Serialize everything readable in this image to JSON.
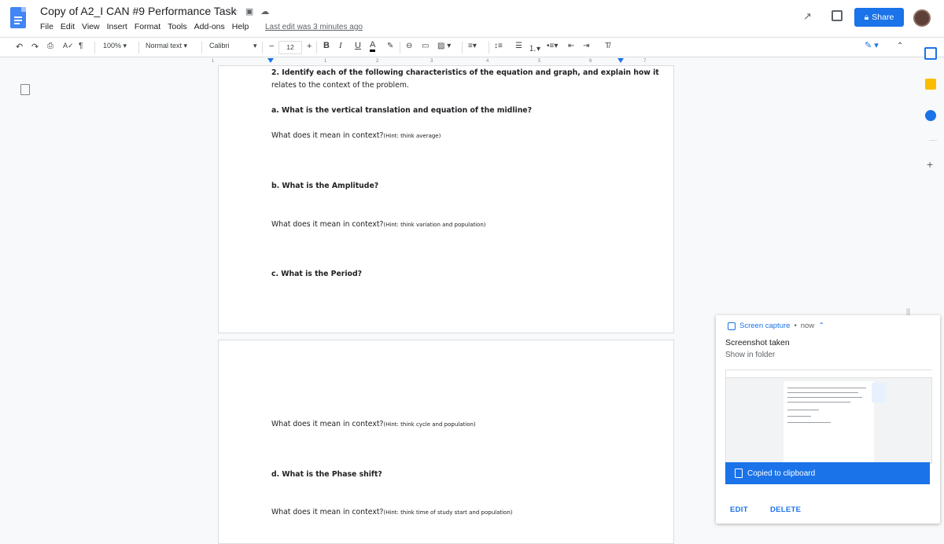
{
  "header": {
    "doc_title": "Copy of A2_I CAN #9 Performance Task",
    "menus": [
      "File",
      "Edit",
      "View",
      "Insert",
      "Format",
      "Tools",
      "Add-ons",
      "Help"
    ],
    "last_edit": "Last edit was 3 minutes ago",
    "share_label": "Share"
  },
  "toolbar": {
    "zoom": "100%",
    "style": "Normal text",
    "font": "Calibri",
    "font_size": "12",
    "bold": "B",
    "italic": "I",
    "underline": "U",
    "text_color": "A"
  },
  "ruler": {
    "marks": [
      "1",
      "1",
      "2",
      "3",
      "4",
      "5",
      "6",
      "7"
    ]
  },
  "document": {
    "q2_line1": "2. Identify each of the following characteristics of the equation and graph, and explain how it",
    "q2_line2": "relates to the context of the problem.",
    "qa": "a. What is the vertical translation and equation of the midline?",
    "ctx_prefix": "What does it mean in context?",
    "hint_a": "(Hint: think average)",
    "qb": "b. What is the Amplitude?",
    "hint_b": "(Hint: think variation and population)",
    "qc": "c. What is the Period?",
    "hint_c": "(Hint: think cycle and population)",
    "qd": "d. What is the Phase shift?",
    "hint_d": "(Hint: think time of study start and population)"
  },
  "notification": {
    "app": "Screen capture",
    "time": "now",
    "title": "Screenshot taken",
    "subtitle": "Show in folder",
    "copied": "Copied to clipboard",
    "edit": "EDIT",
    "delete": "DELETE"
  },
  "colors": {
    "accent": "#1a73e8",
    "docs_blue": "#4285f4"
  }
}
